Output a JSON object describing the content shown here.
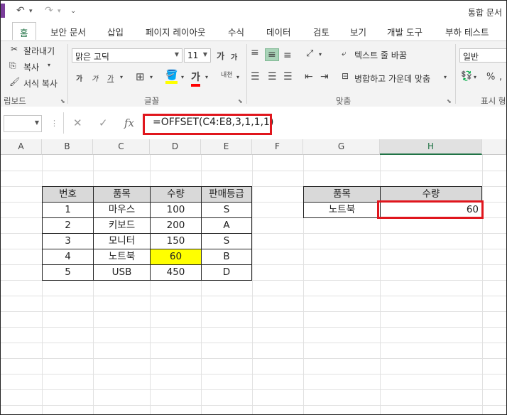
{
  "titlebar": {
    "title": "통합 문서",
    "undo_icon": "undo-icon",
    "redo_icon": "redo-icon"
  },
  "tabs": [
    {
      "label": "홈",
      "active": true
    },
    {
      "label": "보안 문서"
    },
    {
      "label": "삽입"
    },
    {
      "label": "페이지 레이아웃"
    },
    {
      "label": "수식"
    },
    {
      "label": "데이터"
    },
    {
      "label": "검토"
    },
    {
      "label": "보기"
    },
    {
      "label": "개발 도구"
    },
    {
      "label": "부하 테스트"
    }
  ],
  "ribbon": {
    "clipboard": {
      "cut": "잘라내기",
      "copy": "복사",
      "format_painter": "서식 복사",
      "group_label": "립보드"
    },
    "font": {
      "font_name": "맑은 고딕",
      "font_size": "11",
      "group_label": "글꼴",
      "bold": "가",
      "italic": "가",
      "underline": "가",
      "grow": "가",
      "shrink": "가",
      "highlight_glyph": "가",
      "phonetic_glyph": "내천"
    },
    "alignment": {
      "wrap_text": "텍스트 줄 바꿈",
      "merge_center": "병합하고 가운데 맞춤",
      "group_label": "맞춤"
    },
    "number": {
      "format": "일반",
      "percent": "%",
      "group_label": "표시 형"
    }
  },
  "formula_bar": {
    "name_box": "",
    "cancel_glyph": "✕",
    "enter_glyph": "✓",
    "fx_glyph": "fx",
    "formula": "=OFFSET(C4:E8,3,1,1,1)"
  },
  "columns": [
    "A",
    "B",
    "C",
    "D",
    "E",
    "F",
    "G",
    "H"
  ],
  "table1": {
    "headers": [
      "번호",
      "품목",
      "수량",
      "판매등급"
    ],
    "rows": [
      [
        "1",
        "마우스",
        "100",
        "S"
      ],
      [
        "2",
        "키보드",
        "200",
        "A"
      ],
      [
        "3",
        "모니터",
        "150",
        "S"
      ],
      [
        "4",
        "노트북",
        "60",
        "B"
      ],
      [
        "5",
        "USB",
        "450",
        "D"
      ]
    ],
    "highlight_color": "#ffff00"
  },
  "table2": {
    "headers": [
      "품목",
      "수량"
    ],
    "row": [
      "노트북",
      "60"
    ]
  },
  "colors": {
    "excel_green": "#217346",
    "callout_red": "#e0161d",
    "header_fill": "#d9d9d9"
  }
}
